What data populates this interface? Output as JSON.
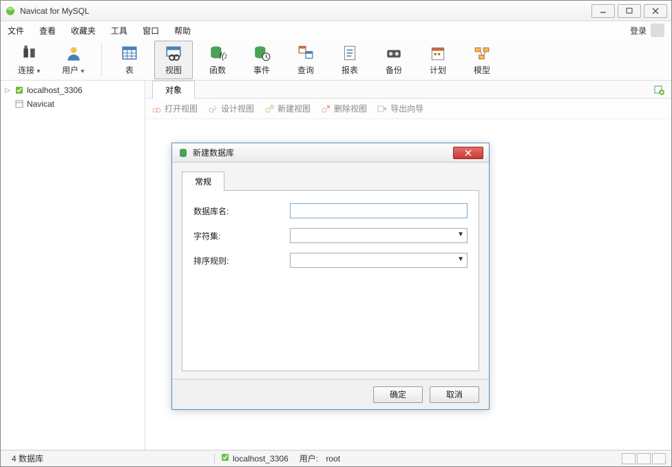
{
  "app": {
    "title": "Navicat for MySQL"
  },
  "menus": {
    "file": "文件",
    "view": "查看",
    "fav": "收藏夹",
    "tools": "工具",
    "window": "窗口",
    "help": "帮助",
    "login": "登录"
  },
  "ribbon": {
    "connect": "连接",
    "user": "用户",
    "table": "表",
    "viewobj": "视图",
    "function": "函数",
    "event": "事件",
    "query": "查询",
    "report": "报表",
    "backup": "备份",
    "plan": "计划",
    "model": "模型"
  },
  "sidebar": {
    "items": [
      {
        "label": "localhost_3306"
      },
      {
        "label": "Navicat"
      }
    ]
  },
  "tabs": {
    "object": "对象"
  },
  "toolbar": {
    "open": "打开视图",
    "design": "设计视图",
    "new": "新建视图",
    "delete": "删除视图",
    "export": "导出向导"
  },
  "dialog": {
    "title": "新建数据库",
    "tab": "常规",
    "dbname_label": "数据库名:",
    "charset_label": "字符集:",
    "collation_label": "排序规则:",
    "dbname_value": "",
    "charset_value": "",
    "collation_value": "",
    "ok": "确定",
    "cancel": "取消"
  },
  "status": {
    "dbs": "4 数据库",
    "conn": "localhost_3306",
    "user_label": "用户:",
    "user": "root"
  }
}
